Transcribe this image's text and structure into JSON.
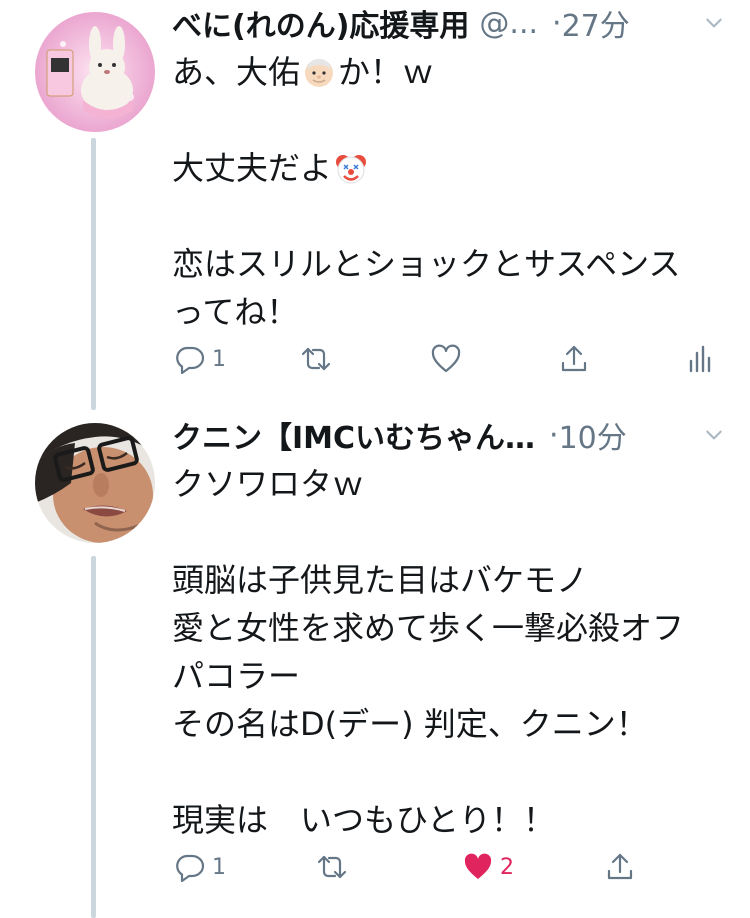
{
  "tweets": [
    {
      "author_name": "べに(れのん)応援専用",
      "handle": "@...",
      "separator": "·",
      "time": "27分",
      "lines": [
        "あ、大佑",
        "か！ｗ",
        "大丈夫だよ",
        "恋はスリルとショックとサスペンス",
        "ってね！"
      ],
      "reply_count": "1",
      "like_count": ""
    },
    {
      "author_name": "クニン【IMCいむちゃん…",
      "separator": "·",
      "time": "10分",
      "lines": [
        "クソワロタｗ",
        "頭脳は子供見た目はバケモノ",
        "愛と女性を求めて歩く一撃必殺オフ",
        "パコラー",
        "その名はD(デー) 判定、クニン！",
        "現実は　いつもひとり！！"
      ],
      "reply_count": "1",
      "like_count": "2"
    }
  ],
  "colors": {
    "text": "#14171a",
    "muted": "#657786",
    "like": "#e0245e",
    "thread": "#ccd6dd"
  }
}
